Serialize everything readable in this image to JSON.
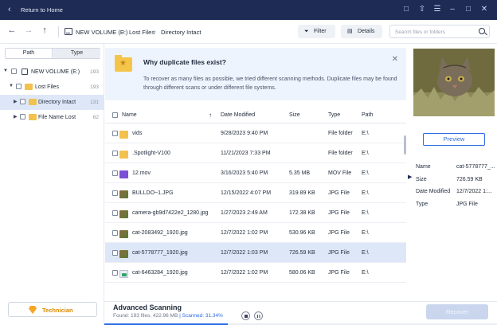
{
  "titlebar": {
    "back_label": "Return to Home"
  },
  "nav": {
    "crumbs": [
      "NEW VOLUME (E:)",
      "Lost Files",
      "Directory Intact"
    ],
    "filter_label": "Filter",
    "details_label": "Details",
    "search_placeholder": "Search files or folders"
  },
  "sidebar": {
    "tab_path": "Path",
    "tab_type": "Type",
    "tree": [
      {
        "label": "NEW VOLUME (E:)",
        "count": "193"
      },
      {
        "label": "Lost Files",
        "count": "193"
      },
      {
        "label": "Directory Intact",
        "count": "131"
      },
      {
        "label": "File Name Lost",
        "count": "62"
      }
    ],
    "technician_label": "Technician"
  },
  "banner": {
    "title": "Why duplicate files exist?",
    "body": "To recover as many files as possible, we tried different scanning methods. Duplicate files may be found through different scans or under different file systems."
  },
  "table": {
    "headers": {
      "name": "Name",
      "date": "Date Modified",
      "size": "Size",
      "type": "Type",
      "path": "Path"
    },
    "rows": [
      {
        "name": "vids",
        "date": "9/28/2023 9:40 PM",
        "size": "",
        "type": "File folder",
        "path": "E:\\",
        "icon": "folder-icon"
      },
      {
        "name": ".Spotlight-V100",
        "date": "11/21/2023 7:33 PM",
        "size": "",
        "type": "File folder",
        "path": "E:\\",
        "icon": "folder-icon"
      },
      {
        "name": "12.mov",
        "date": "3/16/2023 5:40 PM",
        "size": "5.35 MB",
        "type": "MOV File",
        "path": "E:\\",
        "icon": "video-icon"
      },
      {
        "name": "BULLDO~1.JPG",
        "date": "12/15/2022 4:07 PM",
        "size": "319.89 KB",
        "type": "JPG File",
        "path": "E:\\",
        "icon": "image-icon"
      },
      {
        "name": "camera-gb9d7422e2_1280.jpg",
        "date": "1/27/2023 2:49 AM",
        "size": "172.38 KB",
        "type": "JPG File",
        "path": "E:\\",
        "icon": "image-icon"
      },
      {
        "name": "cat-2083492_1920.jpg",
        "date": "12/7/2022 1:02 PM",
        "size": "530.96 KB",
        "type": "JPG File",
        "path": "E:\\",
        "icon": "image-icon"
      },
      {
        "name": "cat-5778777_1920.jpg",
        "date": "12/7/2022 1:03 PM",
        "size": "726.59 KB",
        "type": "JPG File",
        "path": "E:\\",
        "icon": "image-icon"
      },
      {
        "name": "cat-6463284_1920.jpg",
        "date": "12/7/2022 1:02 PM",
        "size": "580.06 KB",
        "type": "JPG File",
        "path": "E:\\",
        "icon": "doc-image-icon"
      }
    ]
  },
  "details": {
    "preview_label": "Preview",
    "props": [
      {
        "label": "Name",
        "value": "cat-5778777_..."
      },
      {
        "label": "Size",
        "value": "726.59 KB"
      },
      {
        "label": "Date Modified",
        "value": "12/7/2022 1:..."
      },
      {
        "label": "Type",
        "value": "JPG File"
      }
    ]
  },
  "status": {
    "title": "Advanced Scanning",
    "found_text": "Found: 193 files, 422.96 MB",
    "scanned_text": "| Scanned: 31.34%",
    "progress": 0.3134,
    "recover_label": "Recover"
  },
  "colors": {
    "titlebar": "#1e2b55",
    "accent": "#2b6be6",
    "selected_row": "#dde7f7",
    "folder": "#f2c14e"
  }
}
